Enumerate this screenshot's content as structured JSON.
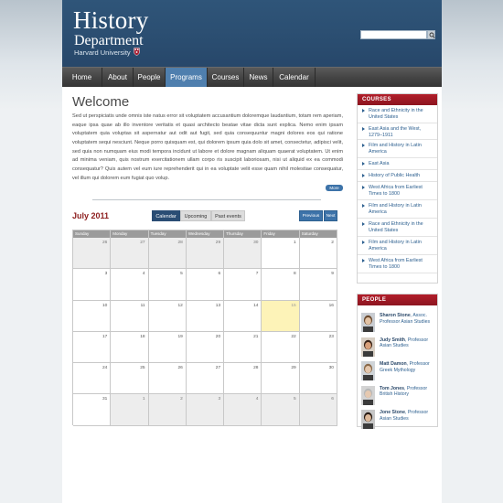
{
  "header": {
    "title": "History",
    "subtitle": "Department",
    "university": "Harvard University",
    "search_placeholder": ""
  },
  "nav": {
    "items": [
      {
        "label": "Home"
      },
      {
        "label": "About"
      },
      {
        "label": "People"
      },
      {
        "label": "Programs",
        "active": true
      },
      {
        "label": "Courses"
      },
      {
        "label": "News"
      },
      {
        "label": "Calendar"
      }
    ]
  },
  "main": {
    "welcome_title": "Welcome",
    "intro": "Sed ut perspiciatis unde omnis iste natus error sit voluptatem accusantium doloremque laudantium, totam rem aperiam, eaque ipsa quae ab illo inventore veritatis et quasi architecto beatae vitae dicta sunt explica. Nemo enim ipsam voluptatem quia voluptas sit aspernatur aut odit aut fugit, sed quia consequuntur magni dolores eos qui ratione voluptatem sequi nesciunt. Neque porro quisquam est, qui dolorem ipsum quia dolo sit amet, consectetur, adipisci velit, sed quia non numquam eius modi tempora incidunt ut labore et dolore magnam aliquam quaerat voluptatem. Ut enim ad minima veniam, quis nostrum exercitationem ullam corpo ris suscipit laboriosam, nisi ut aliquid ex ea commodi consequatur? Quis autem vel eum iure reprehenderit qui in ea voluptate velit esse quam nihil molestiae consequatur, vel illum qui dolorem eum fugiat quo volup.",
    "more_label": "More"
  },
  "calendar": {
    "month": "July 2011",
    "tabs": [
      {
        "label": "Calendar",
        "active": true
      },
      {
        "label": "Upcoming"
      },
      {
        "label": "Past events"
      }
    ],
    "previous_label": "Previous",
    "next_label": "Next",
    "days_of_week": [
      "Sunday",
      "Monday",
      "Tuesday",
      "Wednesday",
      "Thursday",
      "Friday",
      "Saturday"
    ],
    "weeks": [
      [
        {
          "d": "26",
          "o": true
        },
        {
          "d": "27",
          "o": true
        },
        {
          "d": "28",
          "o": true
        },
        {
          "d": "29",
          "o": true
        },
        {
          "d": "30",
          "o": true
        },
        {
          "d": "1"
        },
        {
          "d": "2"
        }
      ],
      [
        {
          "d": "3"
        },
        {
          "d": "4"
        },
        {
          "d": "5"
        },
        {
          "d": "6"
        },
        {
          "d": "7"
        },
        {
          "d": "8"
        },
        {
          "d": "9"
        }
      ],
      [
        {
          "d": "10"
        },
        {
          "d": "11"
        },
        {
          "d": "12"
        },
        {
          "d": "13"
        },
        {
          "d": "14"
        },
        {
          "d": "15",
          "today": true
        },
        {
          "d": "16"
        }
      ],
      [
        {
          "d": "17"
        },
        {
          "d": "18"
        },
        {
          "d": "19"
        },
        {
          "d": "20"
        },
        {
          "d": "21"
        },
        {
          "d": "22"
        },
        {
          "d": "23"
        }
      ],
      [
        {
          "d": "24"
        },
        {
          "d": "25"
        },
        {
          "d": "26"
        },
        {
          "d": "27"
        },
        {
          "d": "28"
        },
        {
          "d": "29"
        },
        {
          "d": "30"
        }
      ],
      [
        {
          "d": "31"
        },
        {
          "d": "1",
          "o": true
        },
        {
          "d": "2",
          "o": true
        },
        {
          "d": "3",
          "o": true
        },
        {
          "d": "4",
          "o": true
        },
        {
          "d": "5",
          "o": true
        },
        {
          "d": "6",
          "o": true
        }
      ]
    ]
  },
  "sidebar": {
    "courses_title": "COURSES",
    "courses": [
      "Race and Ethnicity in the United States",
      "East Asia and the West, 1279–1911",
      "Film and History in Latin America",
      "East Asia",
      "History of Public Health",
      "West Africa from Earliest Times to 1800",
      "Film and History in Latin America",
      "Race and Ethnicity in the United States",
      "Film and History in Latin America",
      "West Africa from Earliest Times to 1800"
    ],
    "people_title": "PEOPLE",
    "people": [
      {
        "name": "Sharon Stone",
        "role": ", Assoc. Professor Asian Studies"
      },
      {
        "name": "Judy Smith",
        "role": ", Professor Asian Studies"
      },
      {
        "name": "Matt Damon",
        "role": ", Professor Greek Mythology"
      },
      {
        "name": "Tom Jones",
        "role": ", Professor British History"
      },
      {
        "name": "Jone Stone",
        "role": ", Professor Asian Studies"
      }
    ]
  },
  "colors": {
    "header_blue": "#2b4e71",
    "nav_active": "#4f7fae",
    "accent_red": "#8c1c1c",
    "link_blue": "#2c5f8f",
    "today_highlight": "#fdf3b8"
  }
}
